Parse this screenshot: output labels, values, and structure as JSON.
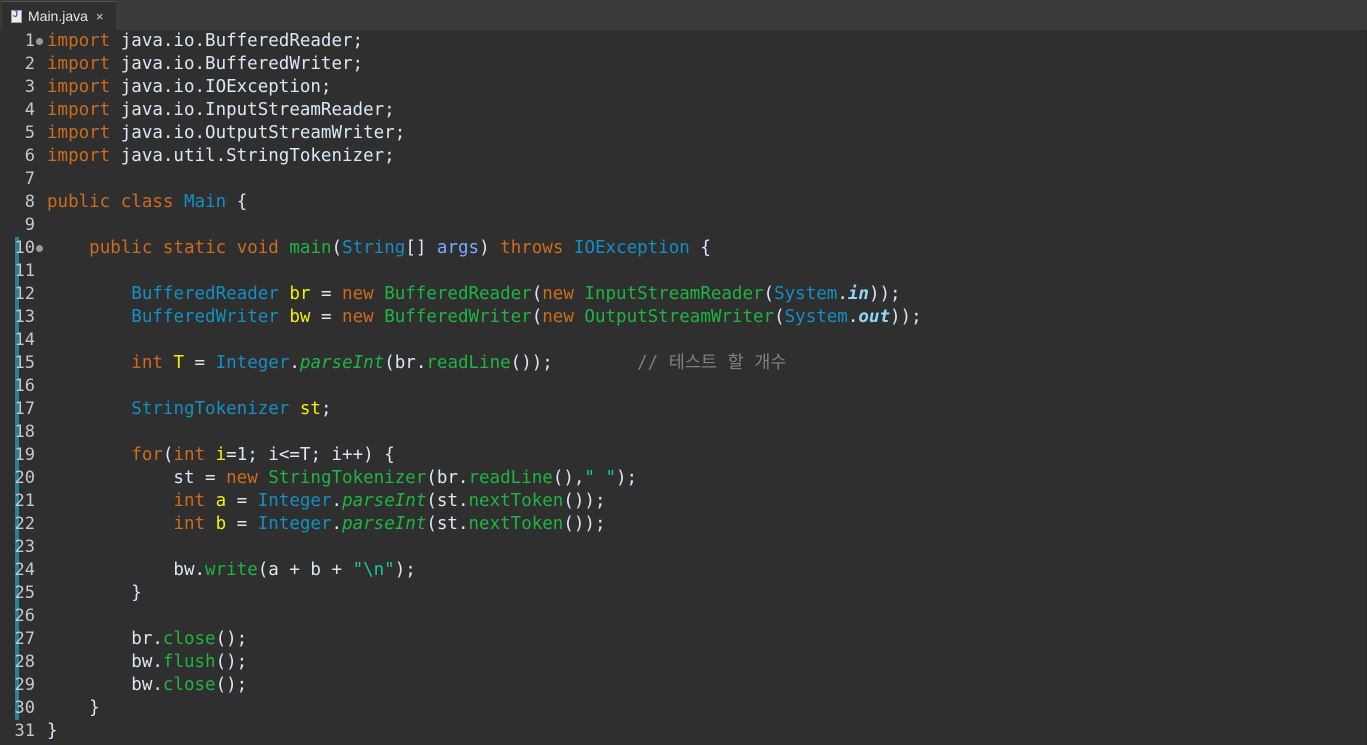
{
  "tab": {
    "title": "Main.java",
    "close_symbol": "×",
    "icon": "java-file-icon"
  },
  "colors": {
    "keyword": "#cc6c1d",
    "type": "#1290c3",
    "variable": "#f2f200",
    "method": "#1eb540",
    "parameter": "#79abff",
    "string": "#17c6a3",
    "comment": "#808080",
    "static_field": "#8dd8f8",
    "plain": "#d9e8f7",
    "background": "#2f2f2f",
    "scope_marker": "#27819a"
  },
  "editor": {
    "lines": [
      {
        "n": "1",
        "fold": true,
        "scope": false,
        "tokens": [
          [
            "kw",
            "import"
          ],
          [
            "tx",
            " java.io.BufferedReader;"
          ]
        ]
      },
      {
        "n": "2",
        "fold": false,
        "scope": false,
        "tokens": [
          [
            "kw",
            "import"
          ],
          [
            "tx",
            " java.io.BufferedWriter;"
          ]
        ]
      },
      {
        "n": "3",
        "fold": false,
        "scope": false,
        "tokens": [
          [
            "kw",
            "import"
          ],
          [
            "tx",
            " java.io.IOException;"
          ]
        ]
      },
      {
        "n": "4",
        "fold": false,
        "scope": false,
        "tokens": [
          [
            "kw",
            "import"
          ],
          [
            "tx",
            " java.io.InputStreamReader;"
          ]
        ]
      },
      {
        "n": "5",
        "fold": false,
        "scope": false,
        "tokens": [
          [
            "kw",
            "import"
          ],
          [
            "tx",
            " java.io.OutputStreamWriter;"
          ]
        ]
      },
      {
        "n": "6",
        "fold": false,
        "scope": false,
        "tokens": [
          [
            "kw",
            "import"
          ],
          [
            "tx",
            " java.util.StringTokenizer;"
          ]
        ]
      },
      {
        "n": "7",
        "fold": false,
        "scope": false,
        "tokens": []
      },
      {
        "n": "8",
        "fold": false,
        "scope": false,
        "tokens": [
          [
            "kw",
            "public"
          ],
          [
            "tx",
            " "
          ],
          [
            "kw",
            "class"
          ],
          [
            "tx",
            " "
          ],
          [
            "ty",
            "Main"
          ],
          [
            "tx",
            " {"
          ]
        ]
      },
      {
        "n": "9",
        "fold": false,
        "scope": false,
        "tokens": []
      },
      {
        "n": "10",
        "fold": true,
        "scope": true,
        "tokens": [
          [
            "tx",
            "    "
          ],
          [
            "kw",
            "public"
          ],
          [
            "tx",
            " "
          ],
          [
            "kw",
            "static"
          ],
          [
            "tx",
            " "
          ],
          [
            "kw",
            "void"
          ],
          [
            "tx",
            " "
          ],
          [
            "mt",
            "main"
          ],
          [
            "tx",
            "("
          ],
          [
            "ty",
            "String"
          ],
          [
            "tx",
            "[] "
          ],
          [
            "pm",
            "args"
          ],
          [
            "tx",
            ") "
          ],
          [
            "kw",
            "throws"
          ],
          [
            "tx",
            " "
          ],
          [
            "ty",
            "IOException"
          ],
          [
            "tx",
            " {"
          ]
        ]
      },
      {
        "n": "11",
        "fold": false,
        "scope": true,
        "tokens": []
      },
      {
        "n": "12",
        "fold": false,
        "scope": true,
        "tokens": [
          [
            "tx",
            "        "
          ],
          [
            "ty",
            "BufferedReader"
          ],
          [
            "tx",
            " "
          ],
          [
            "id",
            "br"
          ],
          [
            "tx",
            " = "
          ],
          [
            "kw",
            "new"
          ],
          [
            "tx",
            " "
          ],
          [
            "mt",
            "BufferedReader"
          ],
          [
            "tx",
            "("
          ],
          [
            "kw",
            "new"
          ],
          [
            "tx",
            " "
          ],
          [
            "mt",
            "InputStreamReader"
          ],
          [
            "tx",
            "("
          ],
          [
            "ty",
            "System"
          ],
          [
            "tx",
            "."
          ],
          [
            "sf",
            "in"
          ],
          [
            "tx",
            "));"
          ]
        ]
      },
      {
        "n": "13",
        "fold": false,
        "scope": true,
        "tokens": [
          [
            "tx",
            "        "
          ],
          [
            "ty",
            "BufferedWriter"
          ],
          [
            "tx",
            " "
          ],
          [
            "id",
            "bw"
          ],
          [
            "tx",
            " = "
          ],
          [
            "kw",
            "new"
          ],
          [
            "tx",
            " "
          ],
          [
            "mt",
            "BufferedWriter"
          ],
          [
            "tx",
            "("
          ],
          [
            "kw",
            "new"
          ],
          [
            "tx",
            " "
          ],
          [
            "mt",
            "OutputStreamWriter"
          ],
          [
            "tx",
            "("
          ],
          [
            "ty",
            "System"
          ],
          [
            "tx",
            "."
          ],
          [
            "sf",
            "out"
          ],
          [
            "tx",
            "));"
          ]
        ]
      },
      {
        "n": "14",
        "fold": false,
        "scope": true,
        "tokens": []
      },
      {
        "n": "15",
        "fold": false,
        "scope": true,
        "tokens": [
          [
            "tx",
            "        "
          ],
          [
            "kw",
            "int"
          ],
          [
            "tx",
            " "
          ],
          [
            "id",
            "T"
          ],
          [
            "tx",
            " = "
          ],
          [
            "ty",
            "Integer"
          ],
          [
            "tx",
            "."
          ],
          [
            "mt ital",
            "parseInt"
          ],
          [
            "tx",
            "(br."
          ],
          [
            "mt",
            "readLine"
          ],
          [
            "tx",
            "());        "
          ],
          [
            "cm",
            "// 테스트 할 개수"
          ]
        ]
      },
      {
        "n": "16",
        "fold": false,
        "scope": true,
        "tokens": []
      },
      {
        "n": "17",
        "fold": false,
        "scope": true,
        "tokens": [
          [
            "tx",
            "        "
          ],
          [
            "ty",
            "StringTokenizer"
          ],
          [
            "tx",
            " "
          ],
          [
            "id",
            "st"
          ],
          [
            "tx",
            ";"
          ]
        ]
      },
      {
        "n": "18",
        "fold": false,
        "scope": true,
        "tokens": []
      },
      {
        "n": "19",
        "fold": false,
        "scope": true,
        "tokens": [
          [
            "tx",
            "        "
          ],
          [
            "kw",
            "for"
          ],
          [
            "tx",
            "("
          ],
          [
            "kw",
            "int"
          ],
          [
            "tx",
            " "
          ],
          [
            "id",
            "i"
          ],
          [
            "tx",
            "=1; i<=T; i++) {"
          ]
        ]
      },
      {
        "n": "20",
        "fold": false,
        "scope": true,
        "tokens": [
          [
            "tx",
            "            st = "
          ],
          [
            "kw",
            "new"
          ],
          [
            "tx",
            " "
          ],
          [
            "mt",
            "StringTokenizer"
          ],
          [
            "tx",
            "(br."
          ],
          [
            "mt",
            "readLine"
          ],
          [
            "tx",
            "(),"
          ],
          [
            "st",
            "\" \""
          ],
          [
            "tx",
            ");"
          ]
        ]
      },
      {
        "n": "21",
        "fold": false,
        "scope": true,
        "tokens": [
          [
            "tx",
            "            "
          ],
          [
            "kw",
            "int"
          ],
          [
            "tx",
            " "
          ],
          [
            "id",
            "a"
          ],
          [
            "tx",
            " = "
          ],
          [
            "ty",
            "Integer"
          ],
          [
            "tx",
            "."
          ],
          [
            "mt ital",
            "parseInt"
          ],
          [
            "tx",
            "(st."
          ],
          [
            "mt",
            "nextToken"
          ],
          [
            "tx",
            "());"
          ]
        ]
      },
      {
        "n": "22",
        "fold": false,
        "scope": true,
        "tokens": [
          [
            "tx",
            "            "
          ],
          [
            "kw",
            "int"
          ],
          [
            "tx",
            " "
          ],
          [
            "id",
            "b"
          ],
          [
            "tx",
            " = "
          ],
          [
            "ty",
            "Integer"
          ],
          [
            "tx",
            "."
          ],
          [
            "mt ital",
            "parseInt"
          ],
          [
            "tx",
            "(st."
          ],
          [
            "mt",
            "nextToken"
          ],
          [
            "tx",
            "());"
          ]
        ]
      },
      {
        "n": "23",
        "fold": false,
        "scope": true,
        "tokens": []
      },
      {
        "n": "24",
        "fold": false,
        "scope": true,
        "tokens": [
          [
            "tx",
            "            bw."
          ],
          [
            "mt",
            "write"
          ],
          [
            "tx",
            "(a + b + "
          ],
          [
            "st",
            "\"\\n\""
          ],
          [
            "tx",
            ");"
          ]
        ]
      },
      {
        "n": "25",
        "fold": false,
        "scope": true,
        "tokens": [
          [
            "tx",
            "        }"
          ]
        ]
      },
      {
        "n": "26",
        "fold": false,
        "scope": true,
        "tokens": []
      },
      {
        "n": "27",
        "fold": false,
        "scope": true,
        "tokens": [
          [
            "tx",
            "        br."
          ],
          [
            "mt",
            "close"
          ],
          [
            "tx",
            "();"
          ]
        ]
      },
      {
        "n": "28",
        "fold": false,
        "scope": true,
        "tokens": [
          [
            "tx",
            "        bw."
          ],
          [
            "mt",
            "flush"
          ],
          [
            "tx",
            "();"
          ]
        ]
      },
      {
        "n": "29",
        "fold": false,
        "scope": true,
        "tokens": [
          [
            "tx",
            "        bw."
          ],
          [
            "mt",
            "close"
          ],
          [
            "tx",
            "();"
          ]
        ]
      },
      {
        "n": "30",
        "fold": false,
        "scope": true,
        "tokens": [
          [
            "tx",
            "    }"
          ]
        ]
      },
      {
        "n": "31",
        "fold": false,
        "scope": false,
        "tokens": [
          [
            "tx",
            "}"
          ]
        ]
      }
    ]
  }
}
